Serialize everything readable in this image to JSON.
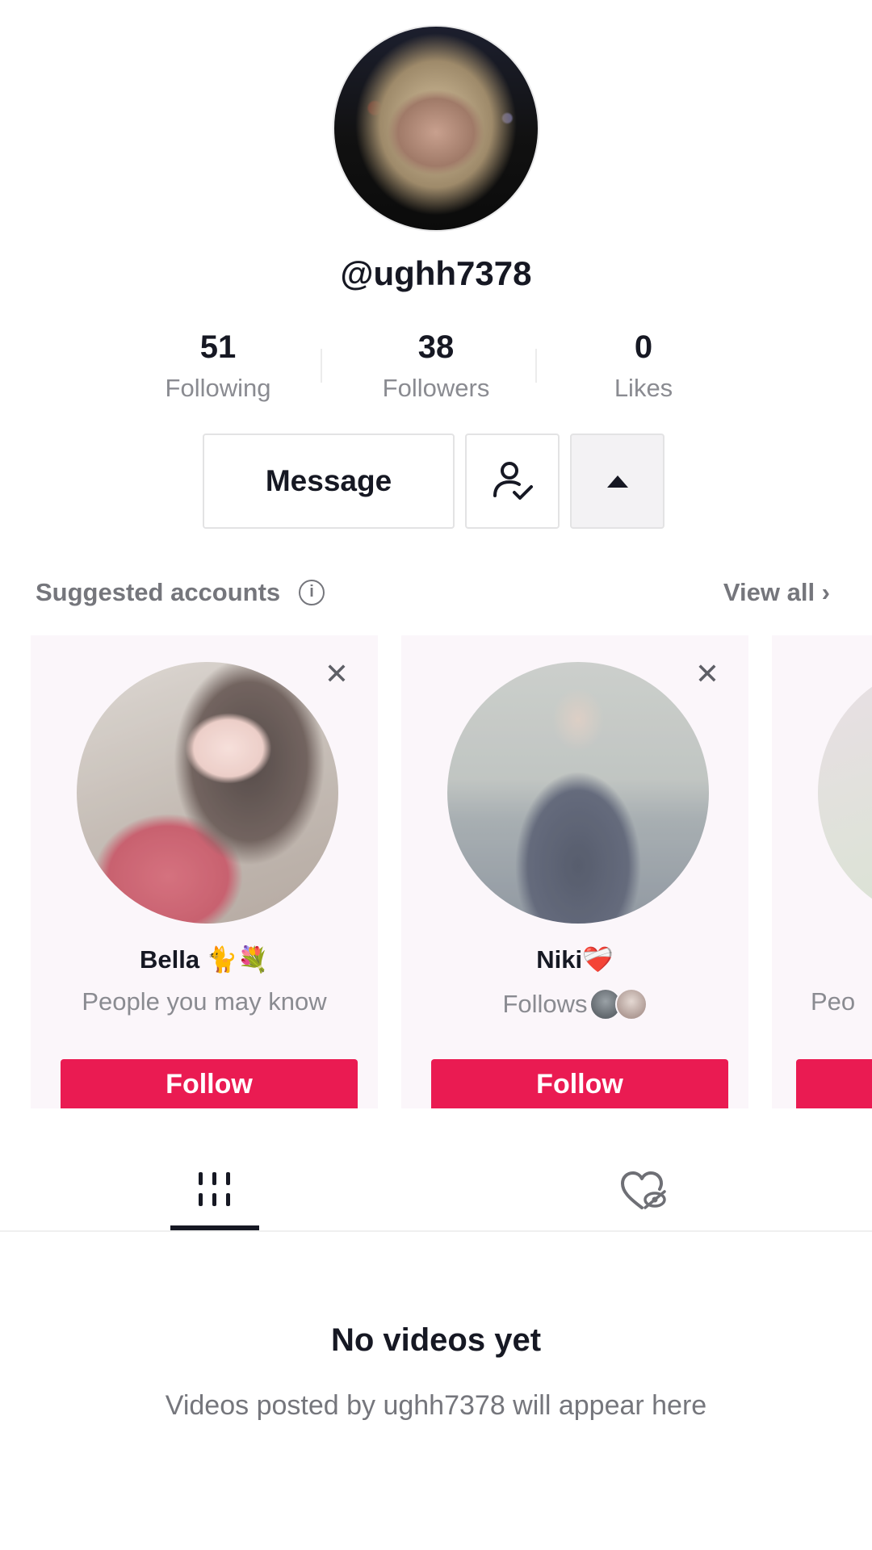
{
  "profile": {
    "username": "@ughh7378"
  },
  "stats": [
    {
      "value": "51",
      "label": "Following"
    },
    {
      "value": "38",
      "label": "Followers"
    },
    {
      "value": "0",
      "label": "Likes"
    }
  ],
  "actions": {
    "message_label": "Message",
    "friend_icon": "person-check-icon",
    "more_icon": "caret-up-icon"
  },
  "suggested": {
    "title": "Suggested accounts",
    "info_icon": "info-icon",
    "view_all": "View all",
    "cards": [
      {
        "name": "Bella 🐈💐",
        "subtitle": "People you may know",
        "follow_label": "Follow",
        "close_icon": "close-icon"
      },
      {
        "name": "Niki❤️‍🩹",
        "subtitle": "Follows",
        "follow_label": "Follow",
        "close_icon": "close-icon"
      },
      {
        "name": "",
        "subtitle": "Peo",
        "follow_label": "",
        "close_icon": "close-icon"
      }
    ]
  },
  "tabs": [
    {
      "icon": "grid-videos-icon",
      "active": true
    },
    {
      "icon": "liked-hidden-icon",
      "active": false
    }
  ],
  "empty_state": {
    "title": "No videos yet",
    "subtitle": "Videos posted by ughh7378 will appear here"
  },
  "colors": {
    "accent": "#ea1b52",
    "text": "#161823",
    "muted": "#8a8b91",
    "card_bg": "#fbf6fa"
  }
}
